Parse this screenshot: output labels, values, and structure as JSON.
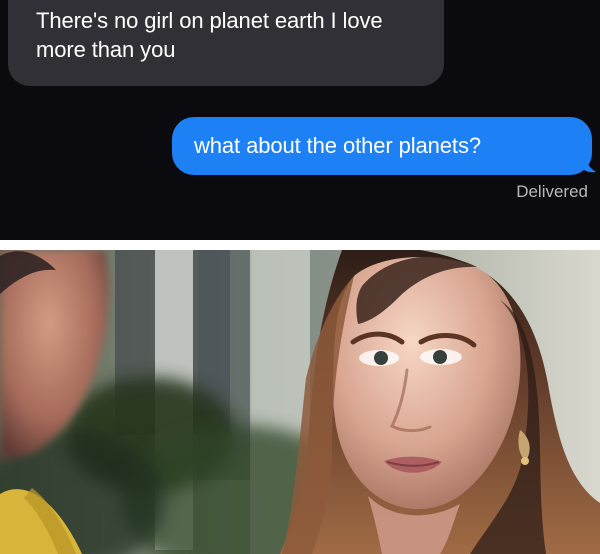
{
  "messages": [
    {
      "direction": "incoming",
      "text": "There's no girl on planet earth I love more than you"
    },
    {
      "direction": "outgoing",
      "text": "what about the other planets?"
    }
  ],
  "status": "Delivered",
  "colors": {
    "chat_background": "#0b0b0f",
    "incoming_bubble": "#303036",
    "outgoing_bubble": "#1e80f5",
    "status_text": "#b7b7bf"
  }
}
